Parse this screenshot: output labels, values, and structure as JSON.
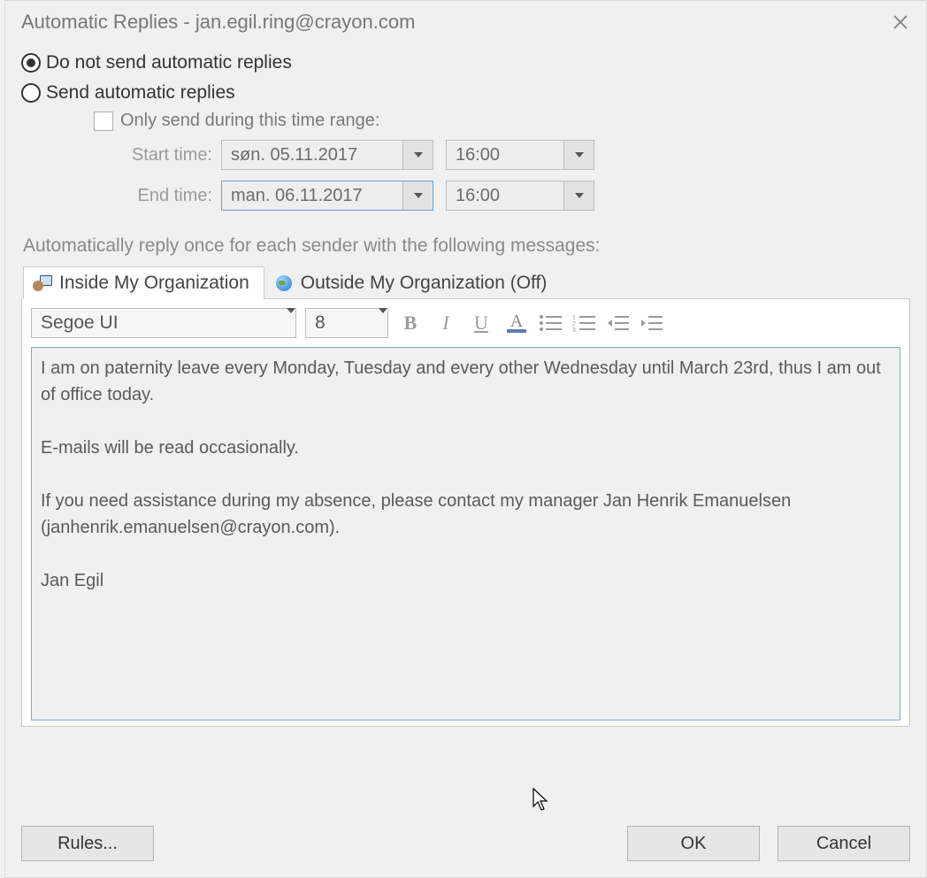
{
  "title": "Automatic Replies - jan.egil.ring@crayon.com",
  "radios": {
    "dont_send": "Do not send automatic replies",
    "send": "Send automatic replies",
    "selected": "dont_send"
  },
  "sub": {
    "only_during_label": "Only send during this time range:"
  },
  "time_labels": {
    "start": "Start time:",
    "end": "End time:"
  },
  "start": {
    "date": "søn. 05.11.2017",
    "time": "16:00"
  },
  "end": {
    "date": "man. 06.11.2017",
    "time": "16:00"
  },
  "hint": "Automatically reply once for each sender with the following messages:",
  "tabs": {
    "inside": "Inside My Organization",
    "outside": "Outside My Organization (Off)"
  },
  "format": {
    "font": "Segoe UI",
    "size": "8"
  },
  "message": "I am on paternity leave every Monday, Tuesday and every other Wednesday until March 23rd, thus I am out of office today.\n\nE-mails will be read occasionally.\n\nIf you need assistance during my absence, please contact my manager Jan Henrik Emanuelsen (janhenrik.emanuelsen@crayon.com).\n\nJan Egil",
  "buttons": {
    "rules": "Rules...",
    "ok": "OK",
    "cancel": "Cancel"
  }
}
